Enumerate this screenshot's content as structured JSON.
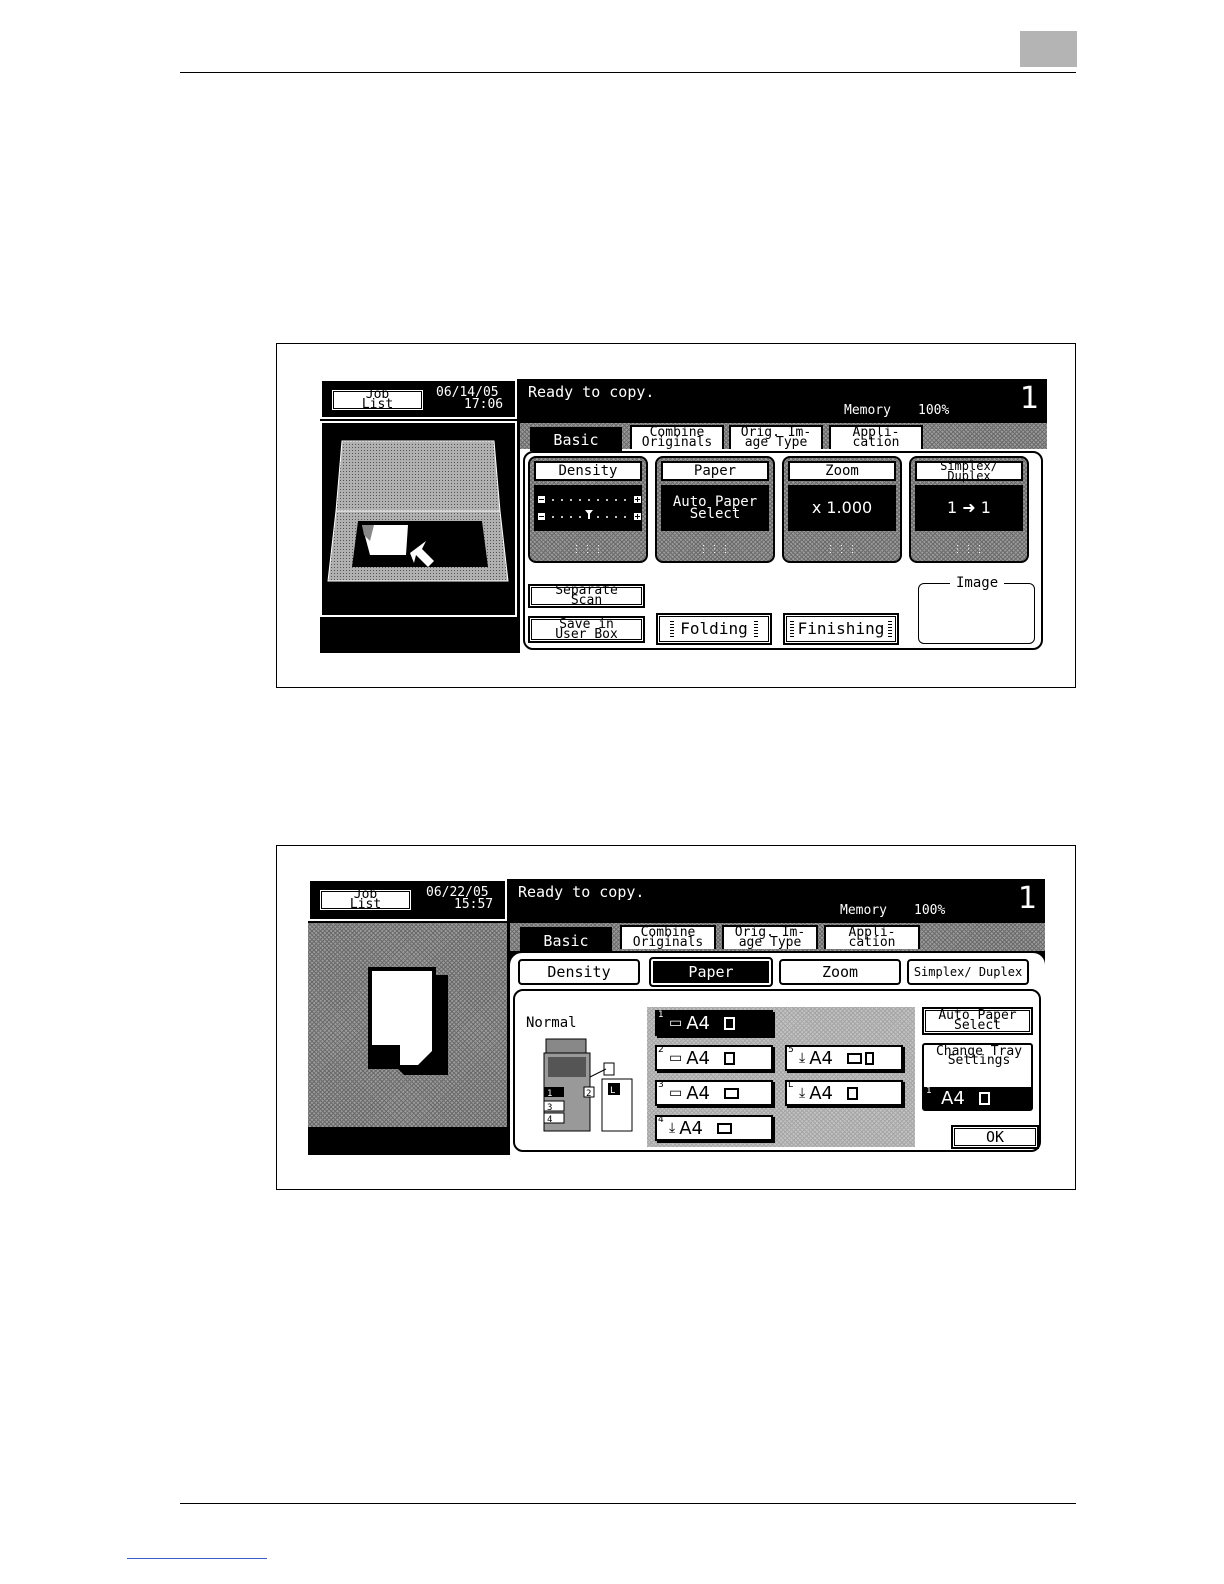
{
  "screen1": {
    "job_list": "Job List",
    "date": "06/14/05",
    "time": "17:06",
    "status": "Ready to copy.",
    "memory_label": "Memory",
    "memory_value": "100%",
    "copy_count": "1",
    "tabs": [
      "Basic",
      "Combine Originals",
      "Orig. Im- age Type",
      "Appli- cation"
    ],
    "functions": [
      {
        "title": "Density",
        "value": ""
      },
      {
        "title": "Paper",
        "value": "Auto Paper Select"
      },
      {
        "title": "Zoom",
        "value": "x 1.000"
      },
      {
        "title": "Simplex/ Duplex",
        "value": "1 ➜ 1"
      }
    ],
    "separate_scan": "Separate Scan",
    "save_user_box": "Save in User Box",
    "folding": "Folding",
    "finishing": "Finishing",
    "image_label": "Image"
  },
  "screen2": {
    "job_list": "Job List",
    "date": "06/22/05",
    "time": "15:57",
    "status": "Ready to copy.",
    "memory_label": "Memory",
    "memory_value": "100%",
    "copy_count": "1",
    "tabs": [
      "Basic",
      "Combine Originals",
      "Orig. Im- age Type",
      "Appli- cation"
    ],
    "sub_tabs": [
      "Density",
      "Paper",
      "Zoom",
      "Simplex/ Duplex"
    ],
    "mode_label": "Normal",
    "trays": [
      {
        "num": "1",
        "size": "A4"
      },
      {
        "num": "2",
        "size": "A4"
      },
      {
        "num": "3",
        "size": "A4"
      },
      {
        "num": "4",
        "size": "A4"
      },
      {
        "num": "5",
        "size": "A4"
      },
      {
        "num": "L",
        "size": "A4"
      }
    ],
    "auto_paper_select": "Auto Paper Select",
    "change_tray_settings": "Change Tray Settings",
    "selected_tray": {
      "num": "1",
      "size": "A4"
    },
    "ok": "OK"
  }
}
